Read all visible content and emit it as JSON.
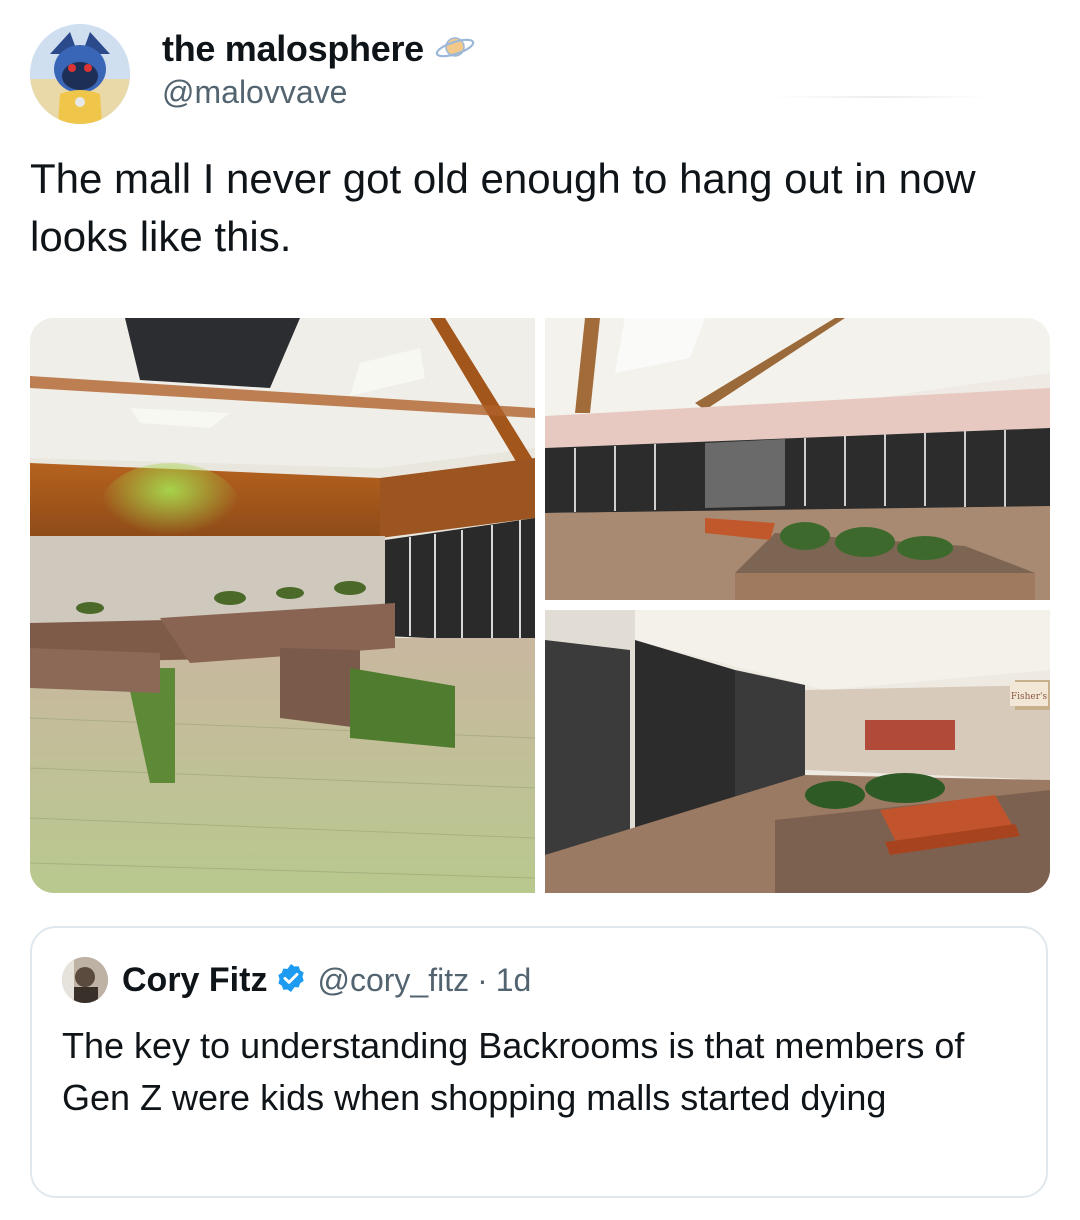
{
  "tweet": {
    "author": {
      "display_name": "the malosphere",
      "handle": "@malovvave",
      "badge_icon": "planet-icon"
    },
    "text": "The mall I never got old enough to hang out in now looks like this."
  },
  "quoted_tweet": {
    "author": {
      "display_name": "Cory Fitz",
      "handle": "@cory_fitz",
      "verified": true,
      "verified_color": "#1d9bf0"
    },
    "separator": "·",
    "time": "1d",
    "text": "The key to understanding Backrooms is that members of Gen Z were kids when shopping malls started dying"
  },
  "media": {
    "count": 3,
    "store_sign": "Fisher's"
  },
  "colors": {
    "text_primary": "#0f1419",
    "text_secondary": "#536471",
    "border": "#e1e8ed"
  }
}
